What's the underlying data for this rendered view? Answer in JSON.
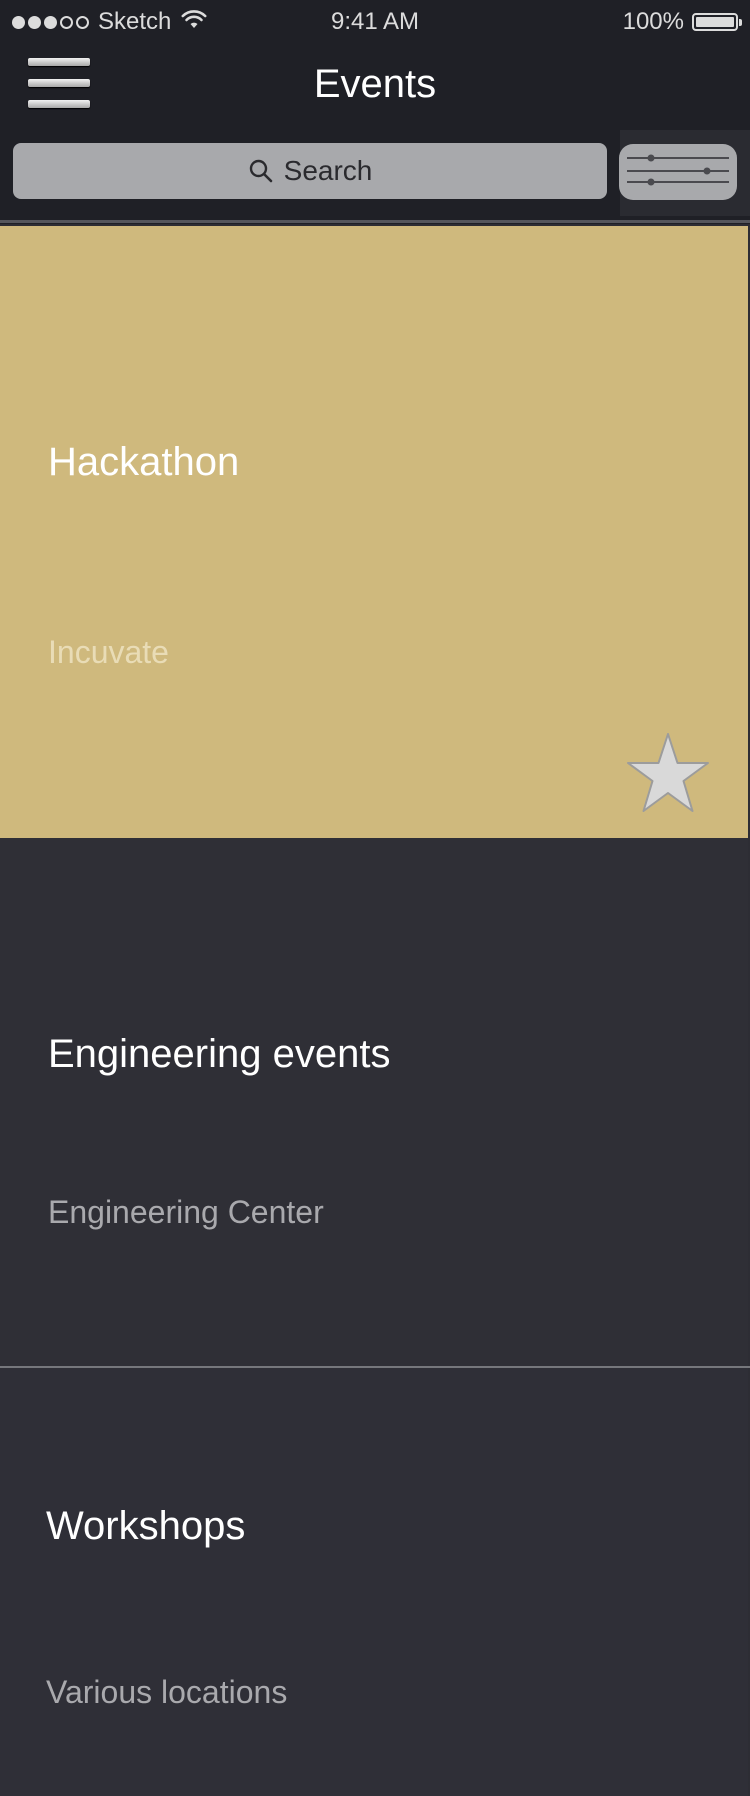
{
  "status_bar": {
    "carrier": "Sketch",
    "time": "9:41 AM",
    "battery": "100%",
    "signal_filled": 3,
    "signal_total": 5
  },
  "header": {
    "title": "Events",
    "menu_icon": "hamburger-menu-icon",
    "filter_icon": "sliders-icon"
  },
  "search": {
    "placeholder": "Search",
    "icon": "search-icon"
  },
  "events": [
    {
      "title": "Hackathon",
      "location": "Incuvate",
      "background": "#cfb97d",
      "favorite_icon": "star-icon"
    },
    {
      "title": "Engineering events",
      "location": "Engineering Center",
      "background": "#2f2f36"
    },
    {
      "title": "Workshops",
      "location": "Various locations",
      "background": "#2f2f37"
    }
  ],
  "colors": {
    "header_background": "#1f2026",
    "accent_gold": "#cfb97d",
    "search_field": "#a8a9ac"
  }
}
